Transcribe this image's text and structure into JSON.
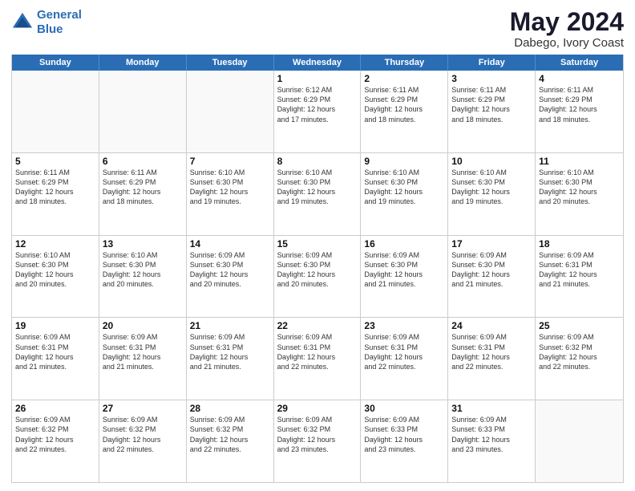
{
  "logo": {
    "line1": "General",
    "line2": "Blue"
  },
  "title": "May 2024",
  "location": "Dabego, Ivory Coast",
  "weekdays": [
    "Sunday",
    "Monday",
    "Tuesday",
    "Wednesday",
    "Thursday",
    "Friday",
    "Saturday"
  ],
  "weeks": [
    [
      {
        "day": "",
        "info": ""
      },
      {
        "day": "",
        "info": ""
      },
      {
        "day": "",
        "info": ""
      },
      {
        "day": "1",
        "info": "Sunrise: 6:12 AM\nSunset: 6:29 PM\nDaylight: 12 hours\nand 17 minutes."
      },
      {
        "day": "2",
        "info": "Sunrise: 6:11 AM\nSunset: 6:29 PM\nDaylight: 12 hours\nand 18 minutes."
      },
      {
        "day": "3",
        "info": "Sunrise: 6:11 AM\nSunset: 6:29 PM\nDaylight: 12 hours\nand 18 minutes."
      },
      {
        "day": "4",
        "info": "Sunrise: 6:11 AM\nSunset: 6:29 PM\nDaylight: 12 hours\nand 18 minutes."
      }
    ],
    [
      {
        "day": "5",
        "info": "Sunrise: 6:11 AM\nSunset: 6:29 PM\nDaylight: 12 hours\nand 18 minutes."
      },
      {
        "day": "6",
        "info": "Sunrise: 6:11 AM\nSunset: 6:29 PM\nDaylight: 12 hours\nand 18 minutes."
      },
      {
        "day": "7",
        "info": "Sunrise: 6:10 AM\nSunset: 6:30 PM\nDaylight: 12 hours\nand 19 minutes."
      },
      {
        "day": "8",
        "info": "Sunrise: 6:10 AM\nSunset: 6:30 PM\nDaylight: 12 hours\nand 19 minutes."
      },
      {
        "day": "9",
        "info": "Sunrise: 6:10 AM\nSunset: 6:30 PM\nDaylight: 12 hours\nand 19 minutes."
      },
      {
        "day": "10",
        "info": "Sunrise: 6:10 AM\nSunset: 6:30 PM\nDaylight: 12 hours\nand 19 minutes."
      },
      {
        "day": "11",
        "info": "Sunrise: 6:10 AM\nSunset: 6:30 PM\nDaylight: 12 hours\nand 20 minutes."
      }
    ],
    [
      {
        "day": "12",
        "info": "Sunrise: 6:10 AM\nSunset: 6:30 PM\nDaylight: 12 hours\nand 20 minutes."
      },
      {
        "day": "13",
        "info": "Sunrise: 6:10 AM\nSunset: 6:30 PM\nDaylight: 12 hours\nand 20 minutes."
      },
      {
        "day": "14",
        "info": "Sunrise: 6:09 AM\nSunset: 6:30 PM\nDaylight: 12 hours\nand 20 minutes."
      },
      {
        "day": "15",
        "info": "Sunrise: 6:09 AM\nSunset: 6:30 PM\nDaylight: 12 hours\nand 20 minutes."
      },
      {
        "day": "16",
        "info": "Sunrise: 6:09 AM\nSunset: 6:30 PM\nDaylight: 12 hours\nand 21 minutes."
      },
      {
        "day": "17",
        "info": "Sunrise: 6:09 AM\nSunset: 6:30 PM\nDaylight: 12 hours\nand 21 minutes."
      },
      {
        "day": "18",
        "info": "Sunrise: 6:09 AM\nSunset: 6:31 PM\nDaylight: 12 hours\nand 21 minutes."
      }
    ],
    [
      {
        "day": "19",
        "info": "Sunrise: 6:09 AM\nSunset: 6:31 PM\nDaylight: 12 hours\nand 21 minutes."
      },
      {
        "day": "20",
        "info": "Sunrise: 6:09 AM\nSunset: 6:31 PM\nDaylight: 12 hours\nand 21 minutes."
      },
      {
        "day": "21",
        "info": "Sunrise: 6:09 AM\nSunset: 6:31 PM\nDaylight: 12 hours\nand 21 minutes."
      },
      {
        "day": "22",
        "info": "Sunrise: 6:09 AM\nSunset: 6:31 PM\nDaylight: 12 hours\nand 22 minutes."
      },
      {
        "day": "23",
        "info": "Sunrise: 6:09 AM\nSunset: 6:31 PM\nDaylight: 12 hours\nand 22 minutes."
      },
      {
        "day": "24",
        "info": "Sunrise: 6:09 AM\nSunset: 6:31 PM\nDaylight: 12 hours\nand 22 minutes."
      },
      {
        "day": "25",
        "info": "Sunrise: 6:09 AM\nSunset: 6:32 PM\nDaylight: 12 hours\nand 22 minutes."
      }
    ],
    [
      {
        "day": "26",
        "info": "Sunrise: 6:09 AM\nSunset: 6:32 PM\nDaylight: 12 hours\nand 22 minutes."
      },
      {
        "day": "27",
        "info": "Sunrise: 6:09 AM\nSunset: 6:32 PM\nDaylight: 12 hours\nand 22 minutes."
      },
      {
        "day": "28",
        "info": "Sunrise: 6:09 AM\nSunset: 6:32 PM\nDaylight: 12 hours\nand 22 minutes."
      },
      {
        "day": "29",
        "info": "Sunrise: 6:09 AM\nSunset: 6:32 PM\nDaylight: 12 hours\nand 23 minutes."
      },
      {
        "day": "30",
        "info": "Sunrise: 6:09 AM\nSunset: 6:33 PM\nDaylight: 12 hours\nand 23 minutes."
      },
      {
        "day": "31",
        "info": "Sunrise: 6:09 AM\nSunset: 6:33 PM\nDaylight: 12 hours\nand 23 minutes."
      },
      {
        "day": "",
        "info": ""
      }
    ]
  ]
}
